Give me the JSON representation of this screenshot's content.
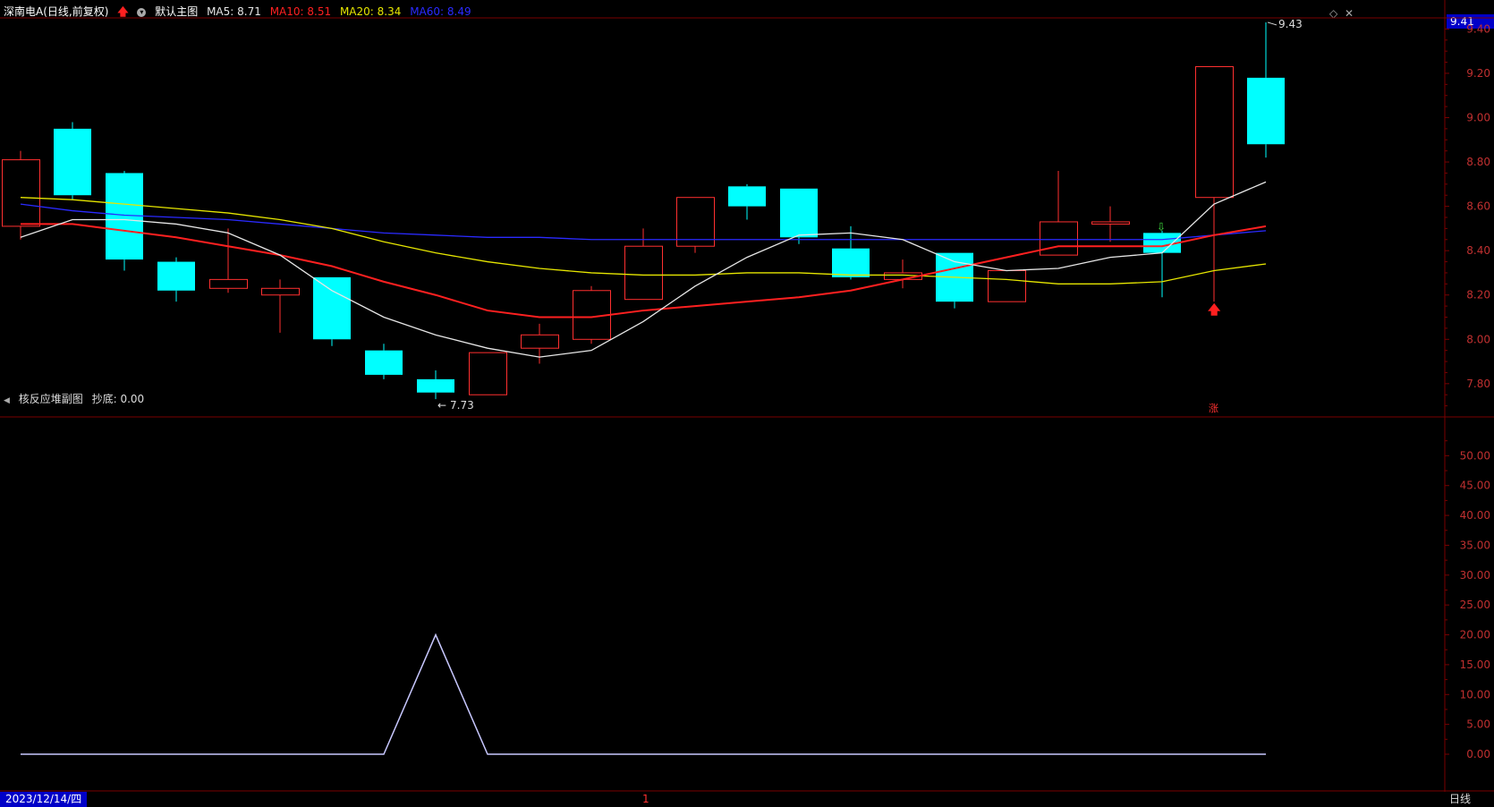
{
  "main_header": {
    "stock": "深南电A",
    "period_mode": "(日线,前复权)",
    "template": "默认主图",
    "ma": [
      {
        "label": "MA5: 8.71",
        "color": "#e6e6e6"
      },
      {
        "label": "MA10: 8.51",
        "color": "#ff2020"
      },
      {
        "label": "MA20: 8.34",
        "color": "#e6e600"
      },
      {
        "label": "MA60: 8.49",
        "color": "#2a2aff"
      }
    ]
  },
  "sub_header": {
    "indicator": "核反应堆副图",
    "value": "抄底: 0.00"
  },
  "current_price": "9.41",
  "status_bar": {
    "date": "2023/12/14/四",
    "marker": "1",
    "period": "日线"
  },
  "annotations": {
    "high": "9.43",
    "low": "7.73",
    "zhang": "涨"
  },
  "chart_data": [
    {
      "type": "candlestick",
      "ylim": [
        7.65,
        9.45
      ],
      "yticks": [
        "9.40",
        "9.20",
        "9.00",
        "8.80",
        "8.60",
        "8.40",
        "8.20",
        "8.00",
        "7.80"
      ],
      "colors": {
        "up": "#ff3030",
        "down": "#00ffff",
        "ma5": "#e6e6e6",
        "ma10": "#ff2020",
        "ma20": "#e6e600",
        "ma60": "#2a2aff"
      },
      "candles": [
        {
          "o": 8.51,
          "c": 8.81,
          "h": 8.85,
          "l": 8.45
        },
        {
          "o": 8.95,
          "c": 8.65,
          "h": 8.98,
          "l": 8.63
        },
        {
          "o": 8.75,
          "c": 8.36,
          "h": 8.76,
          "l": 8.31
        },
        {
          "o": 8.35,
          "c": 8.22,
          "h": 8.37,
          "l": 8.17
        },
        {
          "o": 8.23,
          "c": 8.27,
          "h": 8.5,
          "l": 8.21
        },
        {
          "o": 8.2,
          "c": 8.23,
          "h": 8.27,
          "l": 8.03
        },
        {
          "o": 8.28,
          "c": 8.0,
          "h": 8.28,
          "l": 7.97
        },
        {
          "o": 7.95,
          "c": 7.84,
          "h": 7.98,
          "l": 7.82
        },
        {
          "o": 7.82,
          "c": 7.76,
          "h": 7.86,
          "l": 7.73
        },
        {
          "o": 7.75,
          "c": 7.94,
          "h": 7.94,
          "l": 7.75
        },
        {
          "o": 7.96,
          "c": 8.02,
          "h": 8.07,
          "l": 7.89
        },
        {
          "o": 8.0,
          "c": 8.22,
          "h": 8.24,
          "l": 7.98
        },
        {
          "o": 8.18,
          "c": 8.42,
          "h": 8.5,
          "l": 8.18
        },
        {
          "o": 8.42,
          "c": 8.64,
          "h": 8.64,
          "l": 8.39
        },
        {
          "o": 8.69,
          "c": 8.6,
          "h": 8.7,
          "l": 8.54
        },
        {
          "o": 8.68,
          "c": 8.46,
          "h": 8.68,
          "l": 8.43
        },
        {
          "o": 8.41,
          "c": 8.28,
          "h": 8.51,
          "l": 8.27
        },
        {
          "o": 8.27,
          "c": 8.3,
          "h": 8.36,
          "l": 8.23
        },
        {
          "o": 8.39,
          "c": 8.17,
          "h": 8.39,
          "l": 8.14
        },
        {
          "o": 8.17,
          "c": 8.31,
          "h": 8.31,
          "l": 8.17
        },
        {
          "o": 8.38,
          "c": 8.53,
          "h": 8.76,
          "l": 8.38
        },
        {
          "o": 8.52,
          "c": 8.53,
          "h": 8.6,
          "l": 8.44
        },
        {
          "o": 8.48,
          "c": 8.39,
          "h": 8.49,
          "l": 8.19
        },
        {
          "o": 8.64,
          "c": 9.23,
          "h": 9.23,
          "l": 8.17
        },
        {
          "o": 9.18,
          "c": 8.88,
          "h": 9.43,
          "l": 8.82
        }
      ],
      "ma5": [
        8.46,
        8.54,
        8.54,
        8.52,
        8.48,
        8.38,
        8.22,
        8.1,
        8.02,
        7.96,
        7.92,
        7.95,
        8.08,
        8.24,
        8.37,
        8.47,
        8.48,
        8.45,
        8.35,
        8.31,
        8.32,
        8.37,
        8.39,
        8.61,
        8.71
      ],
      "ma10": [
        8.52,
        8.52,
        8.49,
        8.46,
        8.42,
        8.38,
        8.33,
        8.26,
        8.2,
        8.13,
        8.1,
        8.1,
        8.13,
        8.15,
        8.17,
        8.19,
        8.22,
        8.27,
        8.32,
        8.37,
        8.42,
        8.42,
        8.42,
        8.47,
        8.51
      ],
      "ma20": [
        8.64,
        8.63,
        8.61,
        8.59,
        8.57,
        8.54,
        8.5,
        8.44,
        8.39,
        8.35,
        8.32,
        8.3,
        8.29,
        8.29,
        8.3,
        8.3,
        8.29,
        8.29,
        8.28,
        8.27,
        8.25,
        8.25,
        8.26,
        8.31,
        8.34
      ],
      "ma60": [
        8.61,
        8.58,
        8.56,
        8.55,
        8.54,
        8.52,
        8.5,
        8.48,
        8.47,
        8.46,
        8.46,
        8.45,
        8.45,
        8.45,
        8.45,
        8.45,
        8.45,
        8.45,
        8.45,
        8.45,
        8.45,
        8.45,
        8.45,
        8.47,
        8.49
      ]
    },
    {
      "type": "line",
      "ylim": [
        0,
        55
      ],
      "yticks": [
        "50.00",
        "45.00",
        "40.00",
        "35.00",
        "30.00",
        "25.00",
        "20.00",
        "15.00",
        "10.00",
        "5.00",
        "0.00"
      ],
      "color": "#c8c8ff",
      "values": [
        0,
        0,
        0,
        0,
        0,
        0,
        0,
        0,
        20,
        0,
        0,
        0,
        0,
        0,
        0,
        0,
        0,
        0,
        0,
        0,
        0,
        0,
        0,
        0,
        0
      ]
    }
  ]
}
